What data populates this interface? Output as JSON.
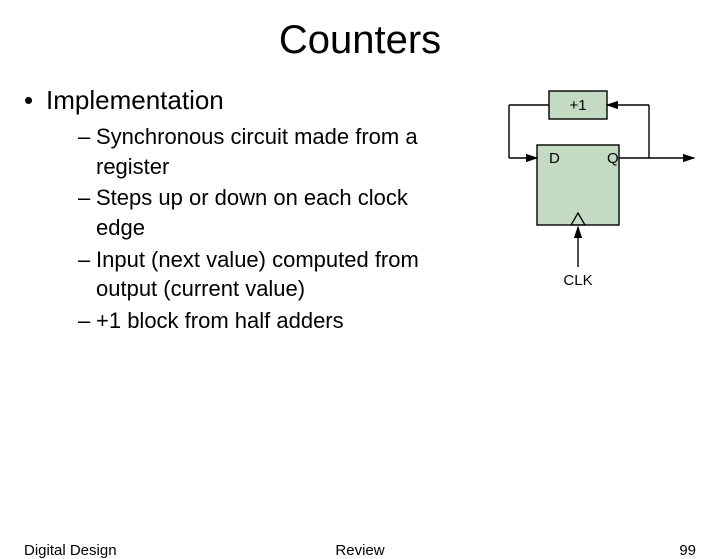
{
  "title": "Counters",
  "heading": "Implementation",
  "bullets": [
    "Synchronous circuit made from a register",
    "Steps up or down on each clock edge",
    "Input (next value) computed from output (current value)",
    "+1 block from half adders"
  ],
  "diagram": {
    "incrementer": "+1",
    "d_label": "D",
    "q_label": "Q",
    "clk_label": "CLK"
  },
  "footer": {
    "left": "Digital Design",
    "center": "Review",
    "right": "99"
  }
}
